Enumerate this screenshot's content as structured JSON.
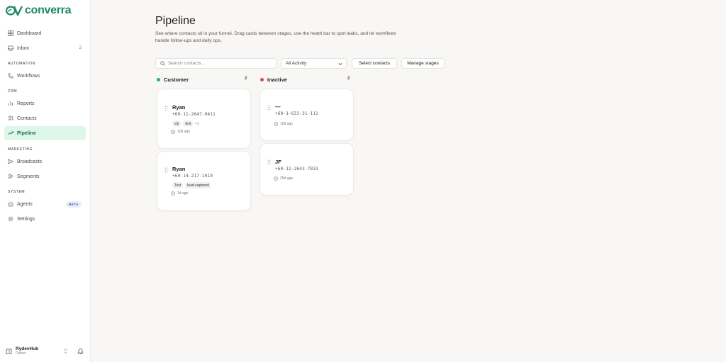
{
  "brand": {
    "name": "converra",
    "color": "#1f8a63"
  },
  "sidebar": {
    "items": [
      {
        "label": "Dashboard",
        "icon": "grid-icon"
      },
      {
        "label": "Inbox",
        "icon": "inbox-icon",
        "badge": "2"
      }
    ],
    "sections": [
      {
        "title": "AUTOMATION",
        "items": [
          {
            "label": "Workflows",
            "icon": "workflow-icon"
          }
        ]
      },
      {
        "title": "CRM",
        "items": [
          {
            "label": "Reports",
            "icon": "bar-chart-icon"
          },
          {
            "label": "Contacts",
            "icon": "users-icon"
          },
          {
            "label": "Pipeline",
            "icon": "trend-icon",
            "active": true
          }
        ]
      },
      {
        "title": "MARKETING",
        "items": [
          {
            "label": "Broadcasts",
            "icon": "send-icon"
          },
          {
            "label": "Segments",
            "icon": "segments-icon"
          }
        ]
      },
      {
        "title": "SYSTEM",
        "items": [
          {
            "label": "Agents",
            "icon": "bot-icon",
            "badge": "BETA"
          },
          {
            "label": "Settings",
            "icon": "gear-icon"
          }
        ]
      }
    ],
    "workspace": {
      "name": "RydevHub",
      "role": "Owner"
    }
  },
  "page": {
    "title": "Pipeline",
    "subtitle": "See where contacts sit in your funnel. Drag cards between stages, use the heath bar to spot leaks, and let workflows handle follow-ups and daily ops."
  },
  "toolbar": {
    "search_placeholder": "Search contacts...",
    "filter_value": "All Activity",
    "select_label": "Select contacts",
    "manage_label": "Manage stages"
  },
  "columns": [
    {
      "name": "Customer",
      "count": "2",
      "color": "#22b07d",
      "cards": [
        {
          "name": "Ryan",
          "phone": "+60-11-2647-0411",
          "tags": [
            "vip",
            "test"
          ],
          "more": "+1",
          "time": "10d ago"
        },
        {
          "name": "Ryan",
          "phone": "+60-14-217-1019",
          "tags": [
            "Test",
            "lead-captured"
          ],
          "more": "",
          "time": "1d ago"
        }
      ]
    },
    {
      "name": "Inactive",
      "count": "2",
      "color": "#e04a4a",
      "cards": [
        {
          "name": "—",
          "phone": "+60-1-633-31-111",
          "tags": [],
          "more": "",
          "time": "15d ago"
        },
        {
          "name": "JF",
          "phone": "+60-11-2643-7833",
          "tags": [],
          "more": "",
          "time": "25d ago"
        }
      ]
    }
  ]
}
